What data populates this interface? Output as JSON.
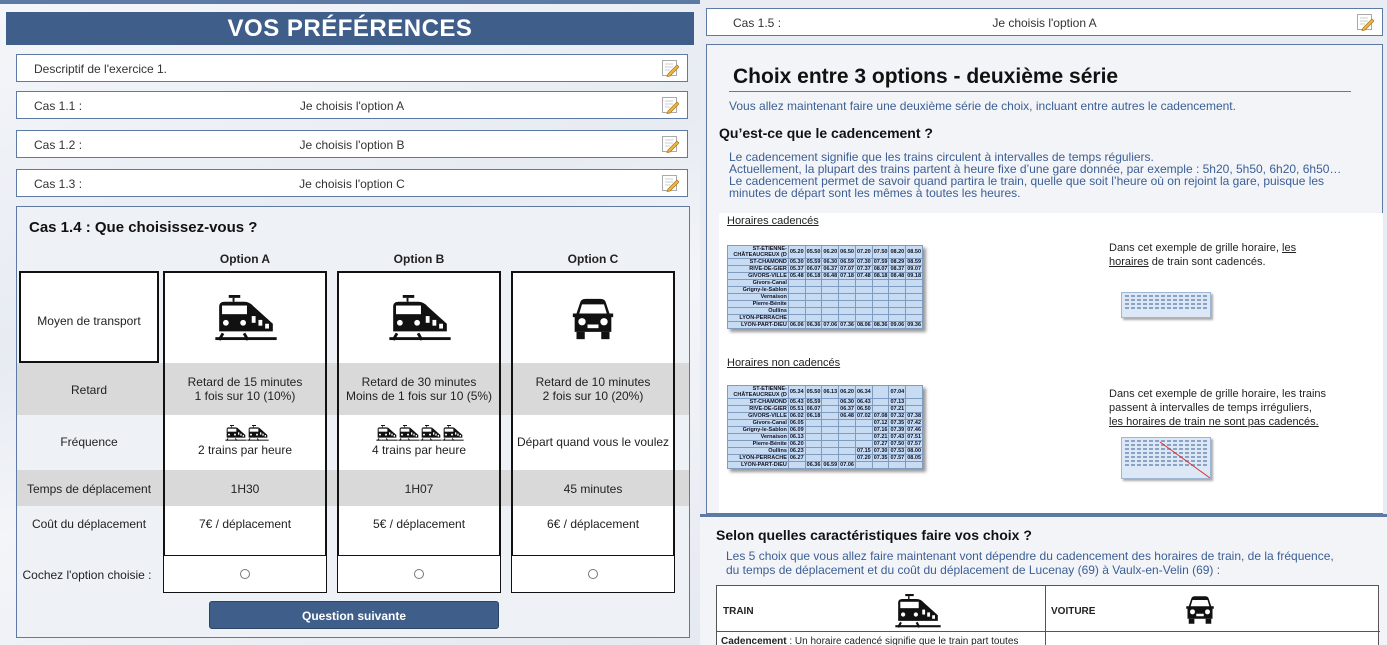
{
  "left": {
    "banner_title": "VOS PRÉFÉRENCES",
    "accordion": [
      {
        "label": "Descriptif de l'exercice 1.",
        "value": ""
      },
      {
        "label": "Cas 1.1 :",
        "value": "Je choisis l'option A"
      },
      {
        "label": "Cas 1.2 :",
        "value": "Je choisis l'option B"
      },
      {
        "label": "Cas 1.3 :",
        "value": "Je choisis l'option C"
      }
    ],
    "question": {
      "title": "Cas 1.4 : Que choisissez-vous ?",
      "options": [
        "Option A",
        "Option B",
        "Option C"
      ],
      "row_labels": {
        "transport": "Moyen de transport",
        "retard": "Retard",
        "frequence": "Fréquence",
        "temps": "Temps de déplacement",
        "cout": "Coût du déplacement",
        "cochez": "Cochez l'option choisie :"
      },
      "retard": [
        [
          "Retard de 15 minutes",
          "1 fois sur 10 (10%)"
        ],
        [
          "Retard de 30 minutes",
          "Moins de 1 fois sur 10 (5%)"
        ],
        [
          "Retard de 10 minutes",
          "2 fois sur 10 (20%)"
        ]
      ],
      "frequence": [
        "2 trains par heure",
        "4 trains par heure",
        "Départ quand vous le voulez"
      ],
      "temps": [
        "1H30",
        "1H07",
        "45 minutes"
      ],
      "cout": [
        "7€ / déplacement",
        "5€ / déplacement",
        "6€ / déplacement"
      ],
      "next_button": "Question suivante"
    }
  },
  "right": {
    "top_row": {
      "label": "Cas 1.5 :",
      "value": "Je choisis l'option A"
    },
    "title": "Choix entre 3 options - deuxième série",
    "intro": "Vous allez maintenant faire une deuxième série de choix, incluant entre autres le cadencement.",
    "q1": "Qu’est-ce que le cadencement ?",
    "para": [
      "Le cadencement signifie que les trains circulent à intervalles de temps réguliers.",
      "Actuellement, la plupart des trains partent à heure fixe d’une gare donnée, par exemple : 5h20, 5h50, 6h20, 6h50…",
      "Le cadencement permet de savoir quand partira le train, quelle que soit l’heure où on rejoint la gare, puisque les minutes de départ sont les mêmes à toutes les heures."
    ],
    "sched1": {
      "heading": "Horaires cadencés",
      "text_a": "Dans cet exemple de grille horaire, ",
      "text_u": "les horaires",
      "text_b": " de train sont cadencés.",
      "rows": [
        [
          "ST-ETIENNE-CHÂTEAUCREUX (D",
          "05.20",
          "05.50",
          "06.20",
          "06.50",
          "07.20",
          "07.50",
          "08.20",
          "08.50"
        ],
        [
          "ST-CHAMOND",
          "05.30",
          "05.59",
          "06.30",
          "06.59",
          "07.30",
          "07.59",
          "08.29",
          "08.59"
        ],
        [
          "RIVE-DE-GIER",
          "05.37",
          "06.07",
          "06.37",
          "07.07",
          "07.37",
          "08.07",
          "08.37",
          "09.07"
        ],
        [
          "GIVORS-VILLE",
          "05.48",
          "06.18",
          "06.48",
          "07.18",
          "07.48",
          "08.18",
          "08.48",
          "09.18"
        ],
        [
          "Givors-Canal",
          "",
          "",
          "",
          "",
          "",
          "",
          "",
          ""
        ],
        [
          "Grigny-le-Sablon",
          "",
          "",
          "",
          "",
          "",
          "",
          "",
          ""
        ],
        [
          "Vernaison",
          "",
          "",
          "",
          "",
          "",
          "",
          "",
          ""
        ],
        [
          "Pierre-Bénite",
          "",
          "",
          "",
          "",
          "",
          "",
          "",
          ""
        ],
        [
          "Oullins",
          "",
          "",
          "",
          "",
          "",
          "",
          "",
          ""
        ],
        [
          "LYON-PERRACHE",
          "",
          "",
          "",
          "",
          "",
          "",
          "",
          ""
        ],
        [
          "LYON-PART-DIEU",
          "06.06",
          "06.36",
          "07.06",
          "07.36",
          "08.06",
          "08.36",
          "09.06",
          "09.36"
        ]
      ]
    },
    "sched2": {
      "heading": "Horaires non cadencés",
      "text_a": "Dans cet exemple de grille horaire, les trains passent à intervalles de temps irréguliers, ",
      "text_u": "les horaires de train ne sont pas cadencés.",
      "rows": [
        [
          "ST-ETIENNE-CHÂTEAUCREUX (D",
          "05.34",
          "05.50",
          "06.13",
          "06.20",
          "06.34",
          "",
          "07.04",
          ""
        ],
        [
          "ST-CHAMOND",
          "05.43",
          "05.59",
          "",
          "06.30",
          "06.43",
          "",
          "07.13",
          ""
        ],
        [
          "RIVE-DE-GIER",
          "05.51",
          "06.07",
          "",
          "06.37",
          "06.50",
          "",
          "07.21",
          ""
        ],
        [
          "GIVORS-VILLE",
          "06.02",
          "06.18",
          "",
          "06.48",
          "07.02",
          "07.08",
          "07.32",
          "07.38"
        ],
        [
          "Givors-Canal",
          "06.05",
          "",
          "",
          "",
          "",
          "07.12",
          "07.35",
          "07.42"
        ],
        [
          "Grigny-le-Sablon",
          "06.09",
          "",
          "",
          "",
          "",
          "07.16",
          "07.39",
          "07.46"
        ],
        [
          "Vernaison",
          "06.13",
          "",
          "",
          "",
          "",
          "07.21",
          "07.43",
          "07.51"
        ],
        [
          "Pierre-Bénite",
          "06.20",
          "",
          "",
          "",
          "",
          "07.27",
          "07.50",
          "07.57"
        ],
        [
          "Oullins",
          "06.23",
          "",
          "",
          "",
          "07.15",
          "07.30",
          "07.53",
          "08.00"
        ],
        [
          "LYON-PERRACHE",
          "06.27",
          "",
          "",
          "",
          "07.20",
          "07.35",
          "07.57",
          "08.05"
        ],
        [
          "LYON-PART-DIEU",
          "",
          "06.36",
          "06.59",
          "07.06",
          "",
          "",
          "",
          ""
        ]
      ]
    },
    "bottom": {
      "title": "Selon quelles caractéristiques faire vos choix ?",
      "text": "Les 5 choix que vous allez faire maintenant vont dépendre du cadencement des horaires de train, de la fréquence, du temps de déplacement et du coût du déplacement de Lucenay (69) à Vaulx-en-Velin (69) :",
      "col_train": "TRAIN",
      "col_voiture": "VOITURE",
      "cad_label": "Cadencement",
      "cad_text": " : Un horaire cadencé signifie que le train part toutes"
    }
  },
  "colors": {
    "accent": "#3f5f8a",
    "border": "#5c7aa3",
    "band": "#d9d9d9",
    "link_text": "#3b5f95"
  }
}
